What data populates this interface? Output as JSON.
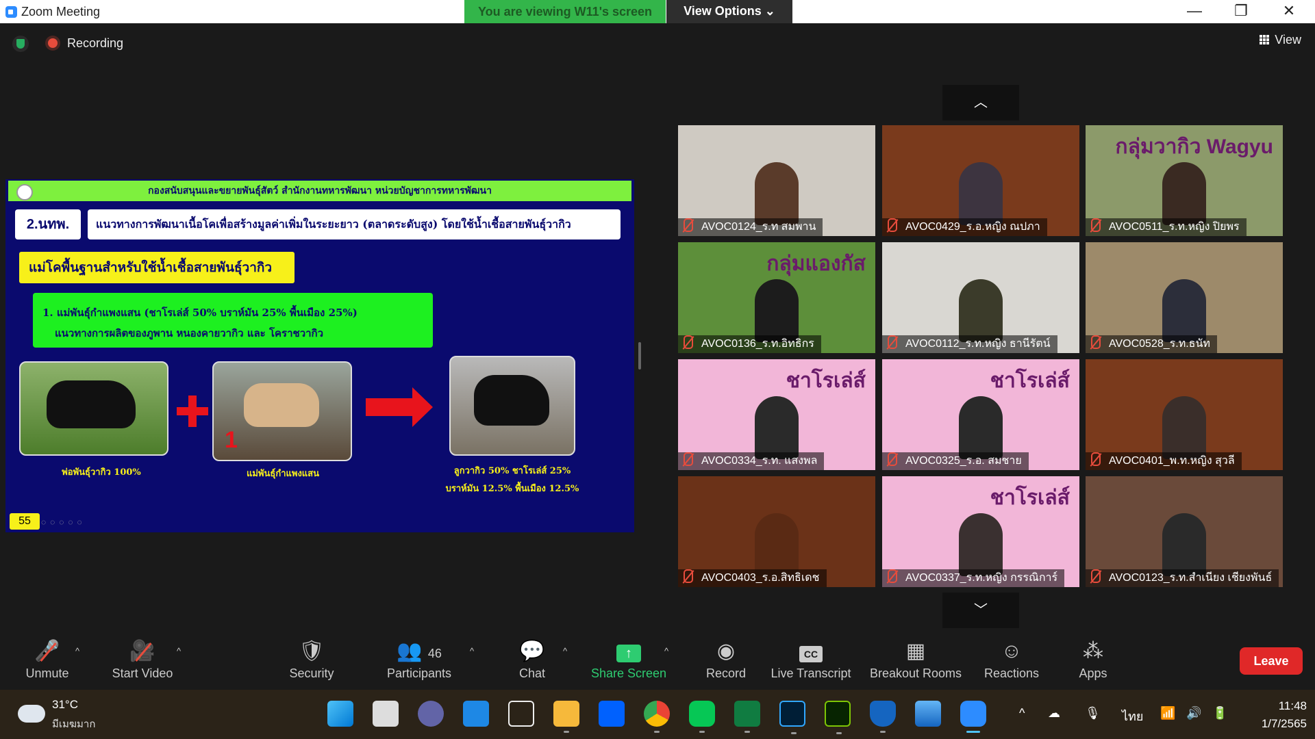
{
  "window": {
    "title": "Zoom Meeting",
    "share_banner": "You are viewing W11's screen",
    "view_options": "View Options",
    "view_options_caret": "⌄",
    "minimize": "—",
    "restore": "❐",
    "close": "✕"
  },
  "topbar": {
    "recording_label": "Recording",
    "view_label": "View"
  },
  "slide": {
    "header": "กองสนับสนุนและขยายพันธุ์สัตว์ สำนักงานทหารพัฒนา หน่วยบัญชาการทหารพัฒนา",
    "code": "2.นทพ.",
    "heading": "แนวทางการพัฒนาเนื้อโคเพื่อสร้างมูลค่าเพิ่มในระยะยาว (ตลาดระดับสูง) โดยใช้น้ำเชื้อสายพันธุ์วากิว",
    "subheading": "แม่โคพื้นฐานสำหรับใช้น้ำเชื้อสายพันธุ์วากิว",
    "point_line1": "1. แม่พันธุ์กำแพงแสน (ชาโรเล่ส์ 50% บราห์มัน 25% พื้นเมือง 25%)",
    "point_line2": "แนวทางการผลิตของภูพาน หนองคายวากิว และ โคราชวากิว",
    "number_mark": "1",
    "caption_sire": "พ่อพันธุ์วากิว 100%",
    "caption_dam": "แม่พันธุ์กำแพงแสน",
    "caption_calf_line1": "ลูกวากิว 50% ชาโรเล่ส์ 25%",
    "caption_calf_line2": "บราห์มัน 12.5% พื้นเมือง 12.5%",
    "page_number": "55",
    "tools": "◌◌◌◌◌"
  },
  "gallery": {
    "up_arrow": "︿",
    "down_arrow": "﹀",
    "tiles": [
      {
        "name": "AVOC0124_ร.ท สมพาน",
        "bg": "#cfcac2",
        "person": "#5a3b2a"
      },
      {
        "name": "AVOC0429_ร.อ.หญิง ณปภา",
        "bg": "#7a3a1c",
        "person": "#3d3440"
      },
      {
        "name": "AVOC0511_ร.ท.หญิง ปิยพร",
        "bg": "#8c9a6a",
        "person": "#3a2a22",
        "overlay": "กลุ่มวากิว Wagyu"
      },
      {
        "name": "AVOC0136_ร.ท.อิทธิกร",
        "bg": "#5d8f3a",
        "person": "#1c1c1c",
        "overlay": "กลุ่มแองกัส"
      },
      {
        "name": "AVOC0112_ร.ท.หญิง ธานีรัตน์",
        "bg": "#d9d7d2",
        "person": "#3b3b2a"
      },
      {
        "name": "AVOC0528_ร.ท.ธนัท",
        "bg": "#9d8a6a",
        "person": "#2c2e3a"
      },
      {
        "name": "AVOC0334_ร.ท. แสงพล",
        "bg": "#f2b6d8",
        "person": "#2a2a2a",
        "overlay": "ชาโรเล่ส์"
      },
      {
        "name": "AVOC0325_ร.อ. สมชาย",
        "bg": "#f2b6d8",
        "person": "#2a2a2a",
        "overlay": "ชาโรเล่ส์"
      },
      {
        "name": "AVOC0401_พ.ท.หญิง สุวลี",
        "bg": "#7a3a1c",
        "person": "#3a2e2a"
      },
      {
        "name": "AVOC0403_ร.อ.สิทธิเดช",
        "bg": "#6b3218",
        "person": "#5a2a14"
      },
      {
        "name": "AVOC0337_ร.ท.หญิง กรรณิการ์",
        "bg": "#f2b6d8",
        "person": "#3a3030",
        "overlay": "ชาโรเล่ส์"
      },
      {
        "name": "AVOC0123_ร.ท.สำเนียง เชียงพันธ์",
        "bg": "#6a4a3a",
        "person": "#2a2a2a"
      }
    ]
  },
  "toolbar": {
    "unmute": "Unmute",
    "start_video": "Start Video",
    "security": "Security",
    "participants": "Participants",
    "participants_count": "46",
    "chat": "Chat",
    "share_screen": "Share Screen",
    "record": "Record",
    "live_transcript": "Live Transcript",
    "breakout_rooms": "Breakout Rooms",
    "reactions": "Reactions",
    "apps": "Apps",
    "leave": "Leave",
    "caret": "^",
    "cc": "CC",
    "share_arrow": "↑"
  },
  "taskbar": {
    "temperature": "31°C",
    "weather_desc": "มีเมฆมาก",
    "time": "11:48",
    "date": "1/7/2565",
    "language": "ไทย",
    "tray_chevron": "^"
  },
  "colors": {
    "share_green": "#33b54a",
    "leave_red": "#e02828",
    "slide_bg": "#0a0a6e",
    "slide_header": "#7ef03e",
    "slide_yellow": "#f7f01a"
  }
}
